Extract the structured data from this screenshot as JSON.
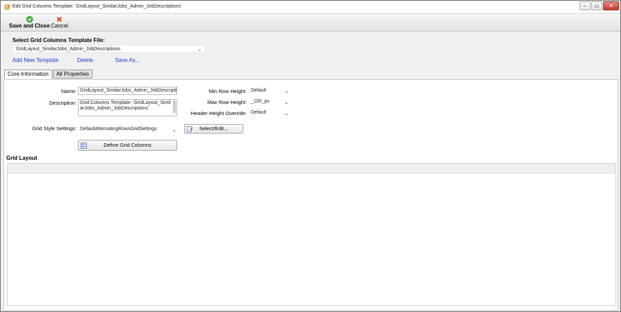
{
  "window": {
    "title": "Edit Grid Columns Template: 'GridLayout_SimilarJobs_Admin_JobDescriptions'",
    "controls": [
      "minimize",
      "restore",
      "close"
    ]
  },
  "toolbar": {
    "save_label": "Save and Close",
    "cancel_label": "Cancel",
    "save_icon_color": "#2fa12f",
    "cancel_icon_color": "#c8501e"
  },
  "template_file": {
    "label": "Select Grid Columns Template File:",
    "selected": "GridLayout_SimilarJobs_Admin_JobDescriptions"
  },
  "actions": {
    "add_new": "Add New Template",
    "delete": "Delete",
    "save_as": "Save As..."
  },
  "tabs": [
    {
      "label": "Core Information",
      "active": true
    },
    {
      "label": "All Properties",
      "active": false
    }
  ],
  "form": {
    "name_label": "Name:",
    "name_value": "GridLayout_SimilarJobs_Admin_JobDescriptio",
    "description_label": "Description:",
    "description_value": "Grid Columns Template: 'GridLayout_SimilarJobs_Admin_JobDescriptions'.",
    "grid_style_label": "Grid Style Settings:",
    "grid_style_value": "DefaultAlternatingRowsGridSettings",
    "select_edit_label": "Select/Edit...",
    "define_columns_label": "Define Grid Columns",
    "min_row_height_label": "Min Row Height:",
    "min_row_height_value": "Default",
    "max_row_height_label": "Max Row Height:",
    "max_row_height_value": "_100_px",
    "header_height_label": "Header Height Override:",
    "header_height_value": "Default"
  },
  "grid_layout": {
    "title": "Grid Layout"
  }
}
